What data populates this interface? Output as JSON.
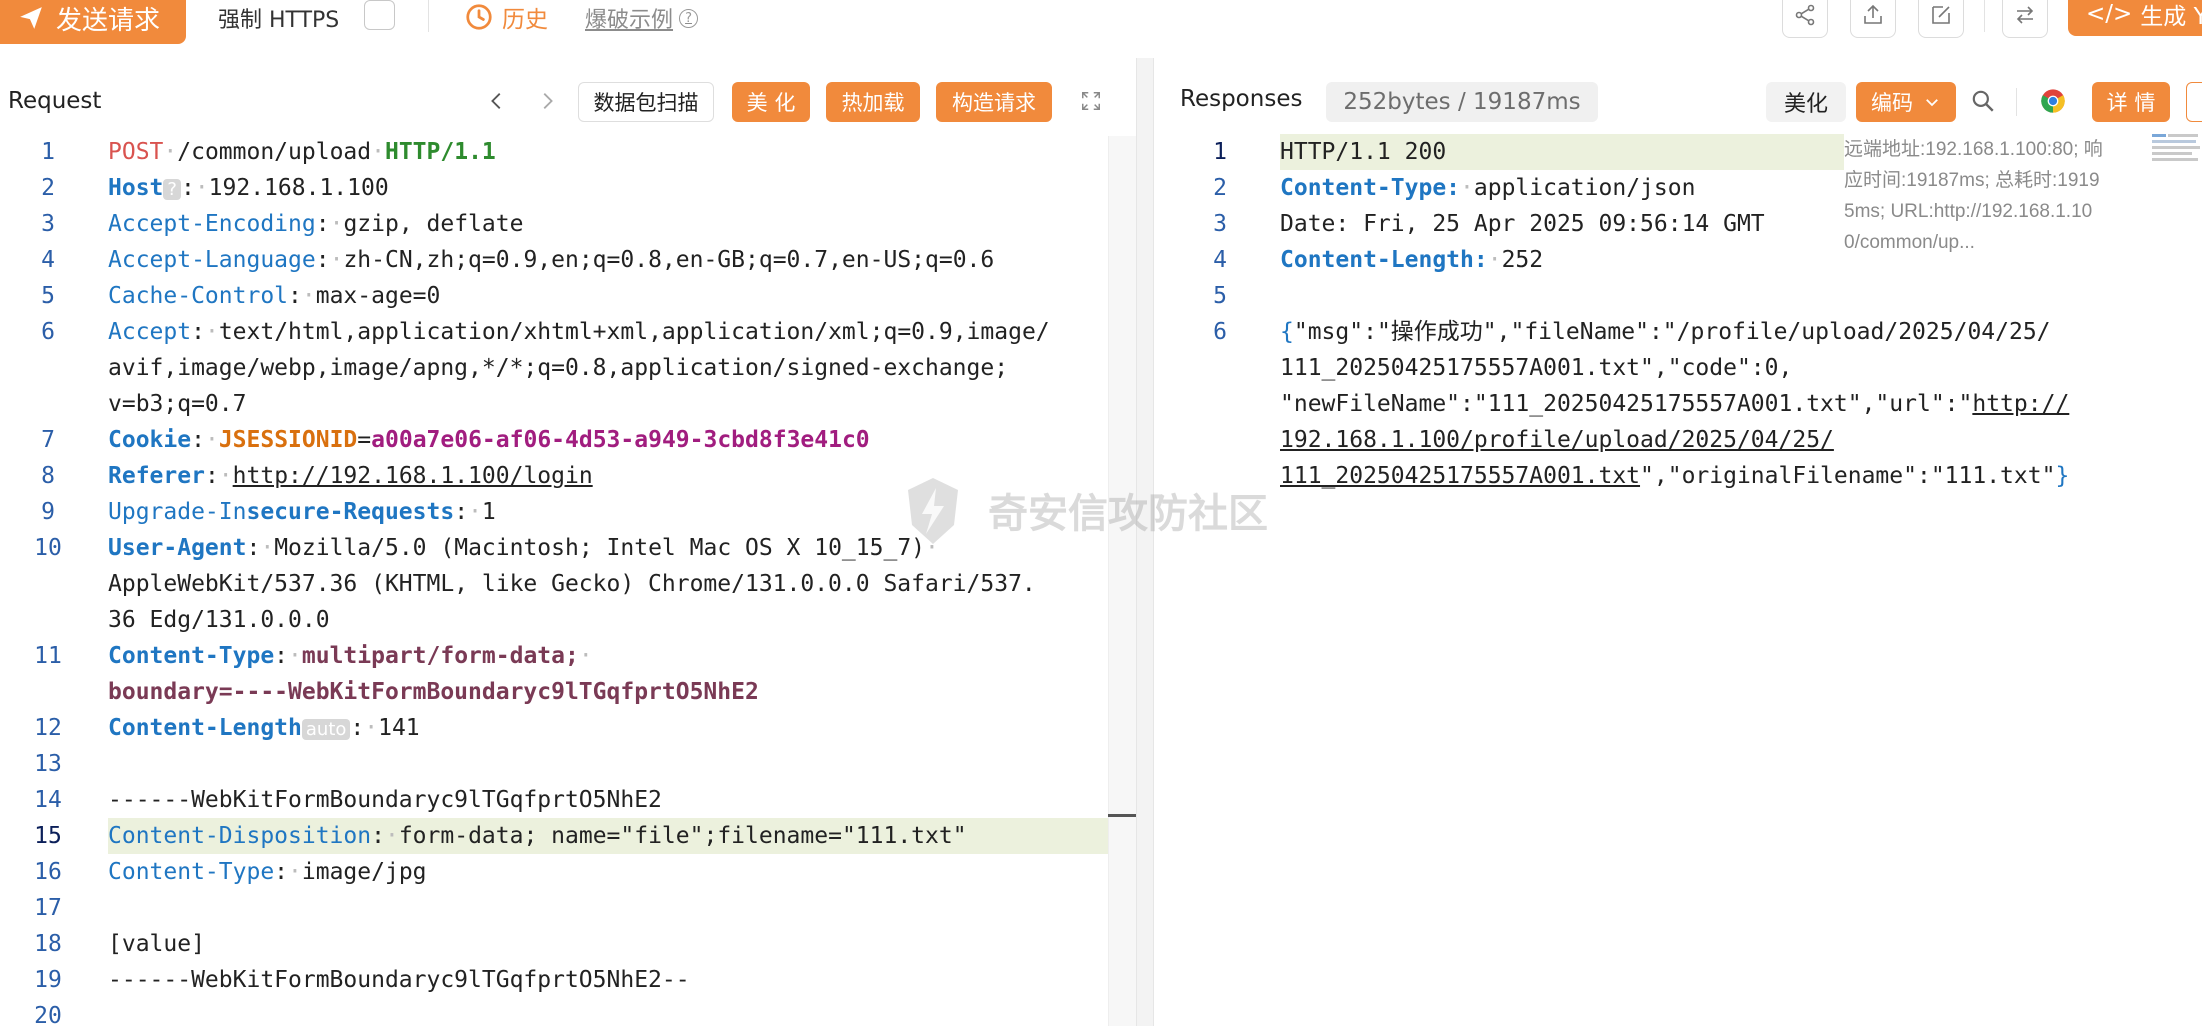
{
  "toolbar": {
    "send_label": "发送请求",
    "force_https_label": "强制 HTTPS",
    "history_label": "历史",
    "example_label": "爆破示例",
    "generate_label": "生成 Ya"
  },
  "request": {
    "title": "Request",
    "scan_label": "数据包扫描",
    "beautify_label": "美 化",
    "hotload_label": "热加载",
    "construct_label": "构造请求",
    "line_numbers": [
      "1",
      "2",
      "3",
      "4",
      "5",
      "6",
      "7",
      "8",
      "9",
      "10",
      "11",
      "12",
      "13",
      "14",
      "15",
      "16",
      "17",
      "18",
      "19",
      "20"
    ],
    "host_badge": "?",
    "length_badge": "auto",
    "lines": {
      "l1_method": "POST",
      "l1_path": "/common/upload",
      "l1_proto": "HTTP/1.1",
      "l2_key": "Host",
      "l2_val": "192.168.1.100",
      "l3_key": "Accept-Encoding",
      "l3_val": "gzip, deflate",
      "l4_key": "Accept-Language",
      "l4_val": "zh-CN,zh;q=0.9,en;q=0.8,en-GB;q=0.7,en-US;q=0.6",
      "l5_key": "Cache-Control",
      "l5_val": "max-age=0",
      "l6_key": "Accept",
      "l6_val_a": "text/html,application/xhtml+xml,application/xml;q=0.9,image/",
      "l6_val_b": "avif,image/webp,image/apng,*/*;q=0.8,application/signed-exchange;",
      "l6_val_c": "v=b3;q=0.7",
      "l7_key": "Cookie",
      "l7_name": "JSESSIONID",
      "l7_val": "a00a7e06-af06-4d53-a949-3cbd8f3e41c0",
      "l8_key": "Referer",
      "l8_val": "http://192.168.1.100/login",
      "l9_key_a": "Upgrade-In",
      "l9_key_b": "secure-Requests",
      "l9_val": "1",
      "l10_key": "User-Agent",
      "l10_val_a": "Mozilla/5.0 (Macintosh; Intel Mac OS X 10_15_7)",
      "l10_val_b": "AppleWebKit/537.36 (KHTML, like Gecko) Chrome/131.0.0.0 Safari/537.",
      "l10_val_c": "36 Edg/131.0.0.0",
      "l11_key": "Content-Type",
      "l11_val_a": "multipart/form-data;",
      "l11_val_b": "boundary=----WebKitFormBoundaryc9lTGqfprtO5NhE2",
      "l12_key": "Content-Length",
      "l12_val": "141",
      "l14": "------WebKitFormBoundaryc9lTGqfprtO5NhE2",
      "l15_key": "Content-Disposition",
      "l15_val": "form-data; name=\"file\";filename=\"111.txt\"",
      "l16_key": "Content-Type",
      "l16_val": "image/jpg",
      "l18": "[value]",
      "l19": "------WebKitFormBoundaryc9lTGqfprtO5NhE2--"
    }
  },
  "response": {
    "title": "Responses",
    "size_info": "252bytes / 19187ms",
    "beautify_label": "美化",
    "encode_label": "编码",
    "details_label": "详 情",
    "line_numbers": [
      "1",
      "2",
      "3",
      "4",
      "5",
      "6"
    ],
    "lines": {
      "l1": "HTTP/1.1 200",
      "l2_key": "Content-Type:",
      "l2_val": "application/json",
      "l3": "Date: Fri, 25 Apr 2025 09:56:14 GMT",
      "l4_key": "Content-Length:",
      "l4_val": "252",
      "l6_a": "\"msg\":\"操作成功\",\"fileName\":\"/profile/upload/2025/04/25/",
      "l6_b": "111_20250425175557A001.txt\",\"code\":0,",
      "l6_c_pre": "\"newFileName\":\"111_20250425175557A001.txt\",\"url\":\"",
      "l6_c_link": "http://",
      "l6_d": "192.168.1.100/profile/upload/2025/04/25/",
      "l6_e_link": "111_20250425175557A001.txt",
      "l6_e_rest": "\",\"originalFilename\":\"111.txt\""
    },
    "meta_line1": "远端地址:192.168.1.100:80; 响",
    "meta_line2": "应时间:19187ms; 总耗时:1919",
    "meta_line3": "5ms; URL:http://192.168.1.10",
    "meta_line4": "0/common/up..."
  },
  "watermark": "奇安信攻防社区",
  "colors": {
    "accent": "#f18a3c",
    "key_blue": "#1f76c2",
    "method_red": "#d9534f",
    "proto_green": "#2e8b2e",
    "highlight": "#ecf1dd"
  }
}
